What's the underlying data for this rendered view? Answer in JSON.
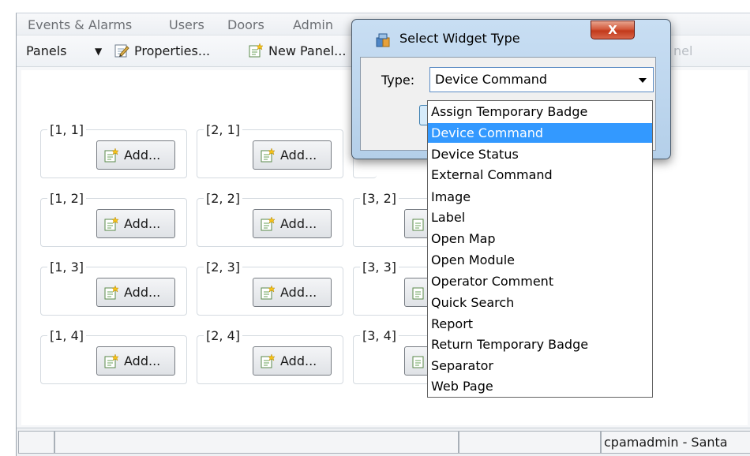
{
  "menubar": {
    "items": [
      "Events & Alarms",
      "Users",
      "Doors",
      "Admin"
    ]
  },
  "toolbar": {
    "panels_label": "Panels",
    "dropdown_arrow": "▼",
    "properties_label": "Properties...",
    "new_panel_label": "New Panel...",
    "ghost_fragment": "nel"
  },
  "grid": {
    "add_label": "Add...",
    "cells": [
      "[1, 1]",
      "[2, 1]",
      "[1, 2]",
      "[2, 2]",
      "[3, 2]",
      "[1, 3]",
      "[2, 3]",
      "[3, 3]",
      "[1, 4]",
      "[2, 4]",
      "[3, 4]"
    ]
  },
  "statusbar": {
    "user_text": "cpamadmin - Santa"
  },
  "dialog": {
    "title": "Select Widget Type",
    "close_label": "X",
    "type_label": "Type:",
    "selected_value": "Device Command"
  },
  "dropdown": {
    "options": [
      "Assign Temporary Badge",
      "Device Command",
      "Device Status",
      "External Command",
      "Image",
      "Label",
      "Open Map",
      "Open Module",
      "Operator Comment",
      "Quick Search",
      "Report",
      "Return Temporary Badge",
      "Separator",
      "Web Page"
    ],
    "selected_index": 1
  },
  "colors": {
    "selection": "#3399ff",
    "dialog_frame": "#b4cfe9",
    "close_button": "#c2391b"
  }
}
